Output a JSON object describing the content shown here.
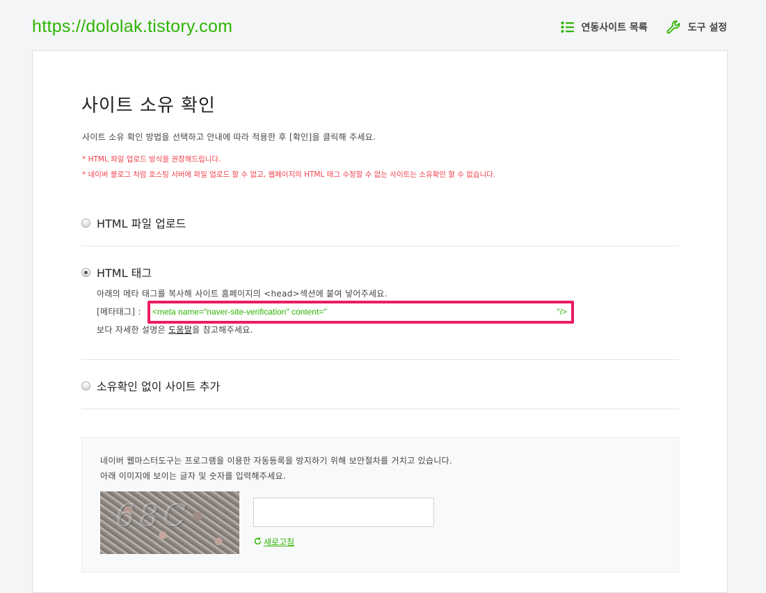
{
  "header": {
    "site_url": "https://dololak.tistory.com",
    "linked_sites_label": "연동사이트 목록",
    "tool_settings_label": "도구 설정"
  },
  "main": {
    "title": "사이트 소유 확인",
    "description": "사이트 소유 확인 방법을 선택하고 안내에 따라 적용한 후 [확인]을 클릭해 주세요.",
    "notes": [
      "* HTML 파일 업로드 방식을 권장해드립니다.",
      "* 네이버 블로그 처럼 호스팅 서버에 파일 업로드 할 수 없고, 웹페이지의 HTML 태그 수정할 수 없는 사이트는 소유확인 할 수 없습니다."
    ],
    "options": [
      {
        "label": "HTML 파일 업로드",
        "checked": false
      },
      {
        "label": "HTML 태그",
        "checked": true
      },
      {
        "label": "소유확인 없이 사이트 추가",
        "checked": false
      }
    ],
    "html_tag": {
      "instruction": "아래의 메타 태그를 복사해 사이트 홈페이지의 <head>섹션에 붙여 넣어주세요.",
      "meta_label": "[메타태그] :",
      "meta_code": "<meta name=\"naver-site-verification\" content=\"",
      "meta_code_end": "\"/>",
      "help_prefix": "보다 자세한 설명은 ",
      "help_link": "도움말",
      "help_suffix": "을 참고해주세요."
    },
    "captcha": {
      "line1": "네이버 웹마스터도구는 프로그램을 이용한 자동등록을 방지하기 위해 보안절차를 거치고 있습니다.",
      "line2": "아래 이미지에 보이는 글자 및 숫자를 입력해주세요.",
      "image_text": "68C",
      "input_value": "",
      "refresh_label": "새로고침"
    }
  },
  "colors": {
    "brand_green": "#2db400",
    "notice_red": "#f1404b",
    "highlight_pink": "#ee1b63"
  },
  "icons": {
    "linked_sites": "list-icon",
    "tool_settings": "wrench-icon",
    "refresh": "refresh-icon"
  }
}
